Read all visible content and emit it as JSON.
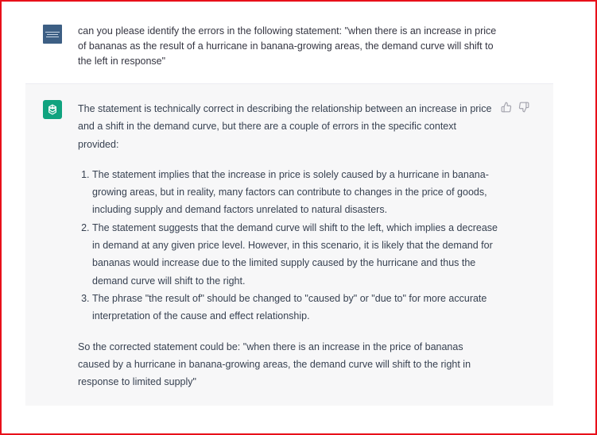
{
  "user_message": {
    "avatar": "user-avatar",
    "text": "can you please identify the errors in the following statement: \"when there is an increase in price of bananas as the result of a hurricane in banana-growing areas, the demand curve will shift to the left in response\""
  },
  "assistant_message": {
    "avatar": "chatgpt-logo-icon",
    "intro": "The statement is technically correct in describing the relationship between an increase in price and a shift in the demand curve, but there are a couple of errors in the specific context provided:",
    "points": [
      "The statement implies that the increase in price is solely caused by a hurricane in banana-growing areas, but in reality, many factors can contribute to changes in the price of goods, including supply and demand factors unrelated to natural disasters.",
      "The statement suggests that the demand curve will shift to the left, which implies a decrease in demand at any given price level. However, in this scenario, it is likely that the demand for bananas would increase due to the limited supply caused by the hurricane and thus the demand curve will shift to the right.",
      "The phrase \"the result of\" should be changed to \"caused by\" or \"due to\" for more accurate interpretation of the cause and effect relationship."
    ],
    "conclusion": "So the corrected statement could be: \"when there is an increase in the price of bananas caused by a hurricane in banana-growing areas, the demand curve will shift to the right in response to limited supply\"",
    "feedback_icons": [
      "thumbs-up-icon",
      "thumbs-down-icon"
    ]
  },
  "colors": {
    "border": "#e8101a",
    "assistant_bg": "#f7f7f8",
    "chatgpt_green": "#10a37f",
    "user_avatar": "#3d5f84",
    "text": "#374151"
  }
}
